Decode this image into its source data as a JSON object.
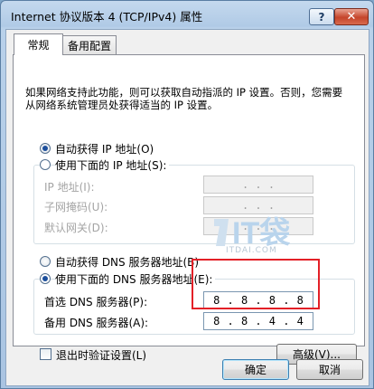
{
  "window": {
    "title": "Internet 协议版本 4 (TCP/IPv4) 属性",
    "help_label": "?",
    "close_label": "✕"
  },
  "tabs": [
    {
      "label": "常规",
      "active": true
    },
    {
      "label": "备用配置",
      "active": false
    }
  ],
  "intro_text": "如果网络支持此功能，则可以获取自动指派的 IP 设置。否则，您需要从网络系统管理员处获得适当的 IP 设置。",
  "ip": {
    "auto_label": "自动获得 IP 地址(O)",
    "auto_checked": true,
    "manual_label": "使用下面的 IP 地址(S):",
    "manual_checked": false,
    "fields": [
      {
        "label": "IP 地址(I):",
        "value": ". . ."
      },
      {
        "label": "子网掩码(U):",
        "value": ". . ."
      },
      {
        "label": "默认网关(D):",
        "value": ". . ."
      }
    ]
  },
  "dns": {
    "auto_label": "自动获得 DNS 服务器地址(B)",
    "auto_checked": false,
    "manual_label": "使用下面的 DNS 服务器地址(E):",
    "manual_checked": true,
    "preferred": {
      "label": "首选 DNS 服务器(P):",
      "octets": [
        "8",
        "8",
        "8",
        "8"
      ]
    },
    "alternate": {
      "label": "备用 DNS 服务器(A):",
      "octets": [
        "8",
        "8",
        "4",
        "4"
      ]
    }
  },
  "validate_label": "退出时验证设置(L)",
  "validate_checked": false,
  "advanced_label": "高级(V)...",
  "ok_label": "确定",
  "cancel_label": "取消",
  "watermark": {
    "logo": "IT袋",
    "text": "ITDAI.COM"
  },
  "colors": {
    "highlight": "#e32027",
    "radio_dot": "#1c4f9c",
    "disabled_text": "#a4a4a4"
  }
}
